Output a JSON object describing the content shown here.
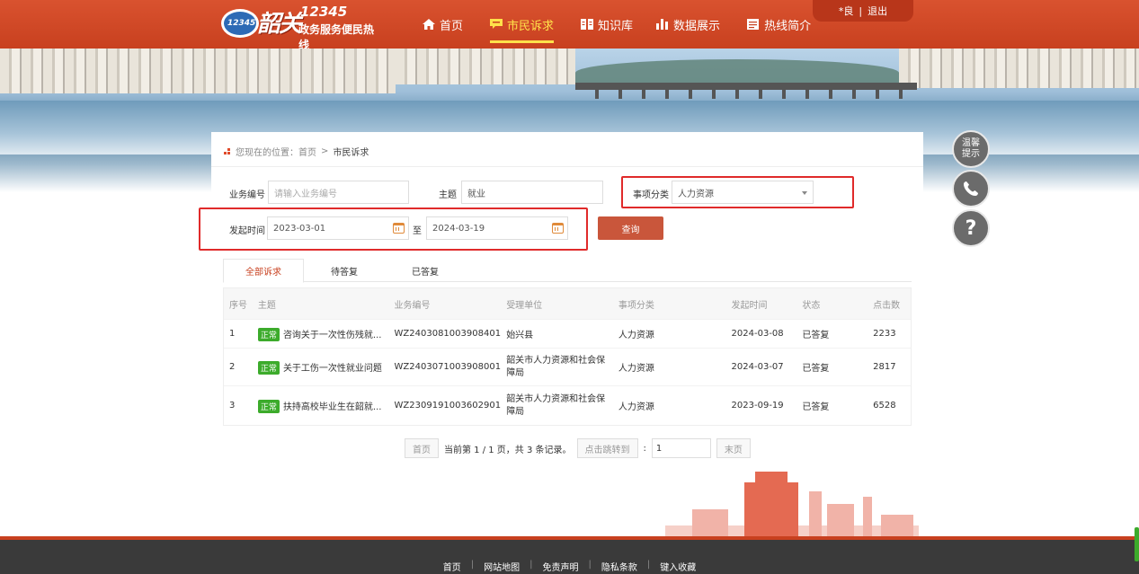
{
  "header": {
    "logo_calligraphy": "韶关",
    "logo_number": "12345",
    "logo_ring_text": "12345",
    "logo_subtitle": "政务服务便民热线",
    "nav": [
      {
        "label": "首页",
        "icon": "home-icon"
      },
      {
        "label": "市民诉求",
        "icon": "message-icon",
        "active": true
      },
      {
        "label": "知识库",
        "icon": "book-icon"
      },
      {
        "label": "数据展示",
        "icon": "bar-chart-icon"
      },
      {
        "label": "热线简介",
        "icon": "document-icon"
      }
    ],
    "user": "*良",
    "user_sep": "|",
    "logout": "退出"
  },
  "breadcrumb": {
    "prefix": "您现在的位置：",
    "home": "首页",
    "sep": ">",
    "current": "市民诉求"
  },
  "filters": {
    "business_no_label": "业务编号",
    "business_no_placeholder": "请输入业务编号",
    "subject_label": "主题",
    "subject_value": "就业",
    "category_label": "事项分类",
    "category_value": "人力资源",
    "time_label": "发起时间",
    "start_date": "2023-03-01",
    "to_label": "至",
    "end_date": "2024-03-19",
    "query_button": "查询"
  },
  "tabs": [
    "全部诉求",
    "待答复",
    "已答复"
  ],
  "table": {
    "headers": [
      "序号",
      "主题",
      "业务编号",
      "受理单位",
      "事项分类",
      "发起时间",
      "状态",
      "点击数"
    ],
    "rows": [
      {
        "no": "1",
        "tag": "正常",
        "title": "咨询关于一次性伤残就...",
        "code": "WZ2403081003908401",
        "unit": "始兴县",
        "category": "人力资源",
        "date": "2024-03-08",
        "status": "已答复",
        "clicks": "2233"
      },
      {
        "no": "2",
        "tag": "正常",
        "title": "关于工伤一次性就业问题",
        "code": "WZ2403071003908001",
        "unit": "韶关市人力资源和社会保障局",
        "category": "人力资源",
        "date": "2024-03-07",
        "status": "已答复",
        "clicks": "2817"
      },
      {
        "no": "3",
        "tag": "正常",
        "title": "扶持高校毕业生在韶就...",
        "code": "WZ2309191003602901",
        "unit": "韶关市人力资源和社会保障局",
        "category": "人力资源",
        "date": "2023-09-19",
        "status": "已答复",
        "clicks": "6528"
      }
    ]
  },
  "pager": {
    "first": "首页",
    "info": "当前第 1 / 1 页，共 3 条记录。",
    "jump": "点击跳转到",
    "colon": ":",
    "page_value": "1",
    "last": "末页"
  },
  "side": {
    "tip": "温馨提示",
    "phone_icon": "phone-icon",
    "help": "?"
  },
  "footer": {
    "links": [
      "首页",
      "网站地图",
      "免责声明",
      "隐私条款",
      "键入收藏"
    ],
    "sep": "|"
  },
  "colors": {
    "brand_red": "#c8401f",
    "active_nav": "#ffe14a",
    "tag_green": "#3cab2b",
    "highlight_box": "#e02a2a"
  }
}
